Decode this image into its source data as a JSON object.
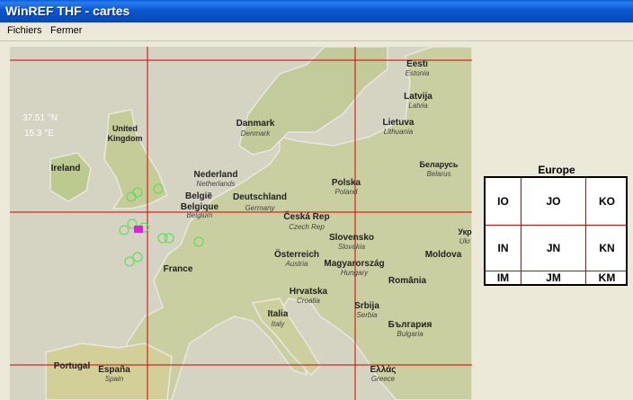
{
  "window": {
    "title": "WinREF THF - cartes"
  },
  "menu": {
    "items": [
      "Fichiers",
      "Fermer"
    ]
  },
  "map": {
    "coords": {
      "lat": "37.51 °N",
      "lon": "15.3 °E"
    },
    "labels": [
      {
        "main": "Eesti",
        "sub": "Estonia"
      },
      {
        "main": "Latvija",
        "sub": "Latvia"
      },
      {
        "main": "Lietuva",
        "sub": "Lithuania"
      },
      {
        "main": "Danmark",
        "sub": "Denmark"
      },
      {
        "main": "United Kingdom",
        "sub": ""
      },
      {
        "main": "Ireland",
        "sub": ""
      },
      {
        "main": "Nederland",
        "sub": "Netherlands"
      },
      {
        "main": "België",
        "sub": "Belgique"
      },
      {
        "main": "Belgique",
        "sub": "Belgium"
      },
      {
        "main": "Deutschland",
        "sub": "Germany"
      },
      {
        "main": "Polska",
        "sub": "Poland"
      },
      {
        "main": "Беларусь",
        "sub": "Belarus"
      },
      {
        "main": "Česká Rep",
        "sub": "Czech Rep"
      },
      {
        "main": "Slovensko",
        "sub": "Slovakia"
      },
      {
        "main": "Укр",
        "sub": "Ukr"
      },
      {
        "main": "France",
        "sub": ""
      },
      {
        "main": "Österreich",
        "sub": "Austria"
      },
      {
        "main": "Magyarország",
        "sub": "Hungary"
      },
      {
        "main": "Moldova",
        "sub": ""
      },
      {
        "main": "România",
        "sub": ""
      },
      {
        "main": "Hrvatska",
        "sub": "Croatia"
      },
      {
        "main": "Srbija",
        "sub": "Serbia"
      },
      {
        "main": "Italia",
        "sub": "Italy"
      },
      {
        "main": "България",
        "sub": "Bulgaria"
      },
      {
        "main": "Portugal",
        "sub": ""
      },
      {
        "main": "España",
        "sub": "Spain"
      },
      {
        "main": "Ελλάς",
        "sub": "Greece"
      }
    ]
  },
  "europe": {
    "title": "Europe",
    "rows": [
      [
        "IO",
        "JO",
        "KO"
      ],
      [
        "IN",
        "JN",
        "KN"
      ],
      [
        "IM",
        "JM",
        "KM"
      ]
    ]
  },
  "colors": {
    "grid_line": "#d00000",
    "station_marker": "#50e050",
    "selected_marker": "#e020e0"
  }
}
